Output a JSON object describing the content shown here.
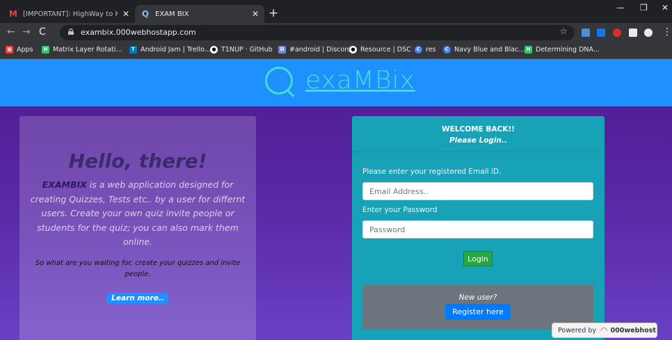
{
  "browser": {
    "tabs": [
      {
        "title": "[IMPORTANT]: HighWay to Highl",
        "favicon": "gmail-icon",
        "color": "#ea4335"
      },
      {
        "title": "EXAM BIX",
        "favicon": "search-q-icon",
        "color": "#8ab4f8"
      }
    ],
    "url": "exambix.000webhostapp.com",
    "bookmarks": [
      {
        "label": "Apps",
        "icon": "apps-grid-icon",
        "color": "#e8453c"
      },
      {
        "label": "Matrix Layer Rotati...",
        "icon": "hackerrank-icon",
        "color": "#2ec866"
      },
      {
        "label": "Android Jam | Trello...",
        "icon": "trello-icon",
        "color": "#0079bf"
      },
      {
        "label": "T1NUP · GitHub",
        "icon": "github-icon",
        "color": "#ffffff"
      },
      {
        "label": "#android | Discord",
        "icon": "discord-icon",
        "color": "#7289da"
      },
      {
        "label": "Resource | DSC",
        "icon": "github-icon",
        "color": "#ffffff"
      },
      {
        "label": "res",
        "icon": "c-icon",
        "color": "#3b82f6"
      },
      {
        "label": "Navy Blue and Blac...",
        "icon": "c-icon",
        "color": "#3b82f6"
      },
      {
        "label": "Determining DNA...",
        "icon": "hackerrank-icon",
        "color": "#2ec866"
      }
    ]
  },
  "site": {
    "brand": "exaMBix",
    "hello": {
      "title": "Hello, there!",
      "brand_word": "EXAMBIX",
      "description": " is a web application designed for creating Quizzes, Tests etc.. by a user for differnt users. Create your own quiz invite people or students for the quiz; you can also mark them online.",
      "waiting": "So what are you waiting for, create your quizzes and invite people.",
      "learn_more": "Learn more.."
    },
    "login": {
      "welcome": "WELCOME BACK!!",
      "please": "Please Login..",
      "email_label": "Please enter your registered Email ID.",
      "email_placeholder": "Email Address..",
      "password_label": "Enter your Password",
      "password_placeholder": "Password",
      "login_button": "Login",
      "new_user": "New user?",
      "register_button": "Register here"
    },
    "powered_by": "Powered by",
    "host": "000webhost"
  }
}
